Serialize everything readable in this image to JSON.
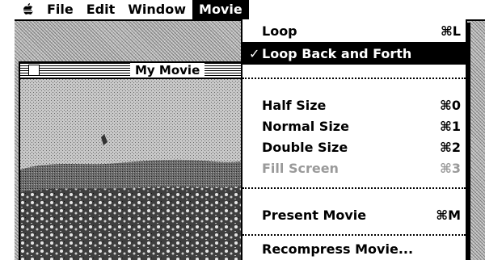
{
  "menubar": {
    "apple_icon": "apple-icon",
    "items": [
      {
        "label": "File"
      },
      {
        "label": "Edit"
      },
      {
        "label": "Window"
      },
      {
        "label": "Movie",
        "active": true
      }
    ]
  },
  "window": {
    "title": "My Movie",
    "close_icon": "close-box-icon"
  },
  "movie_menu": {
    "items": [
      {
        "label": "Loop",
        "shortcut": "⌘L"
      },
      {
        "label": "Loop Back and Forth",
        "shortcut": "",
        "checked": true
      },
      {
        "label": "Half Size",
        "shortcut": "⌘0"
      },
      {
        "label": "Normal Size",
        "shortcut": "⌘1"
      },
      {
        "label": "Double Size",
        "shortcut": "⌘2"
      },
      {
        "label": "Fill Screen",
        "shortcut": "⌘3",
        "disabled": true
      },
      {
        "label": "Present Movie",
        "shortcut": "⌘M"
      },
      {
        "label": "Recompress Movie...",
        "shortcut": ""
      }
    ],
    "check_mark": "✓"
  },
  "colors": {
    "black": "#000000",
    "white": "#ffffff",
    "disabled": "#9a9a9a",
    "desktop": "#bdbdbd"
  }
}
